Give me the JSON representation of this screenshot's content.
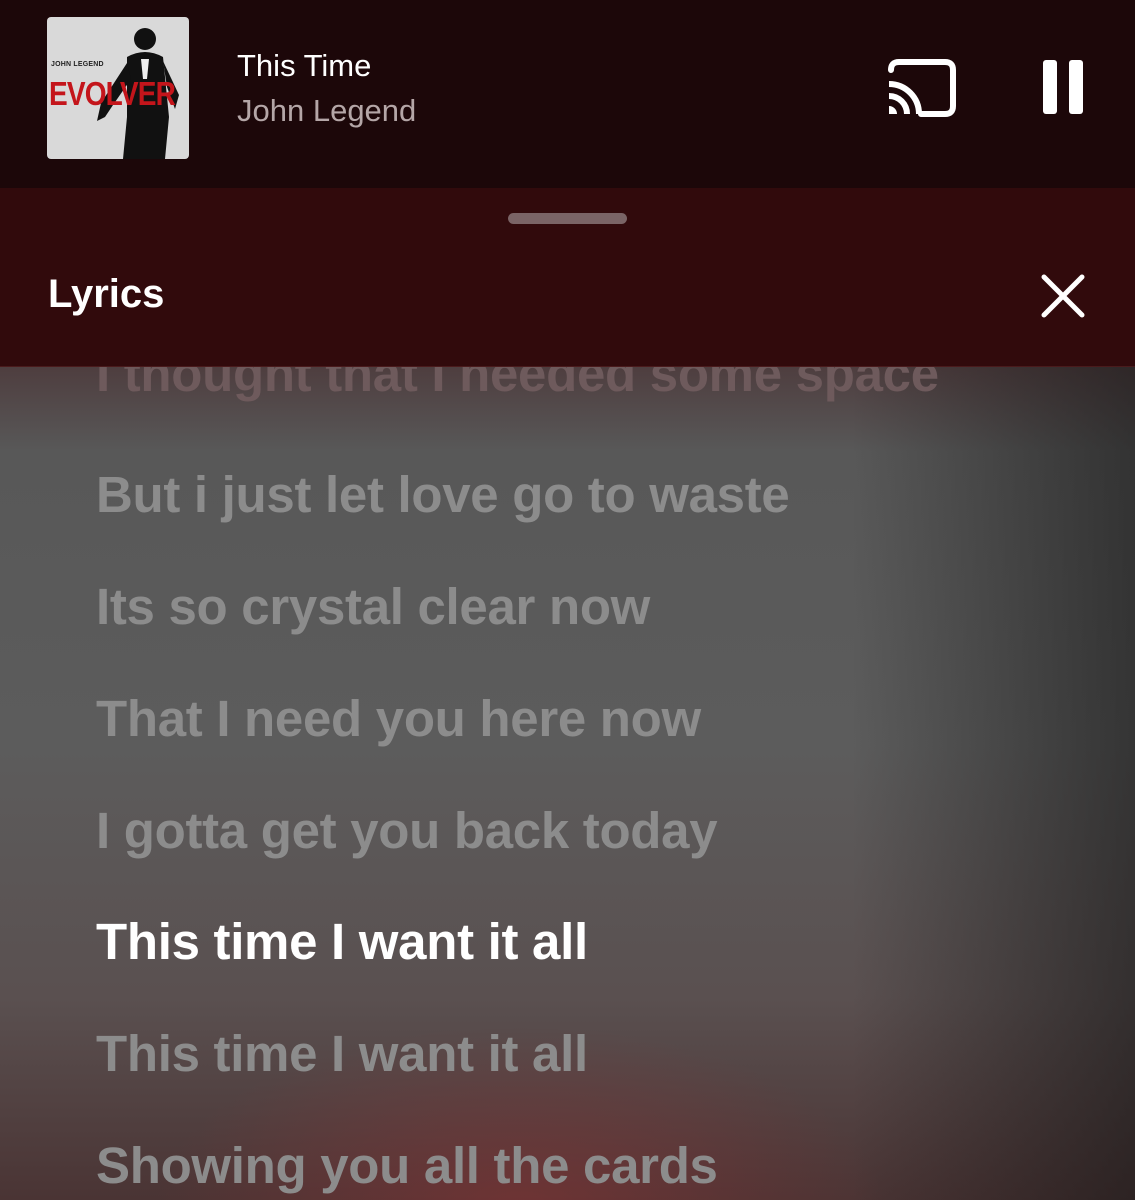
{
  "now_playing": {
    "title": "This Time",
    "artist": "John Legend",
    "album_art": {
      "artist_text": "JOHN LEGEND",
      "album_text": "EVOLVER"
    }
  },
  "controls": {
    "cast_icon": "cast-icon",
    "pause_icon": "pause-icon"
  },
  "lyrics_panel": {
    "title": "Lyrics",
    "close_icon": "close-icon",
    "lines": [
      "I thought that I needed some space",
      "But i just let love go to waste",
      "Its so crystal clear now",
      "That I need you here now",
      "I gotta get you back today",
      "This time I want it all",
      "This time I want it all",
      "Showing you all the cards"
    ],
    "active_index": 5
  },
  "colors": {
    "mini_player_bg": "#1c0709",
    "sheet_header_bg": "#310a0c",
    "active_lyric": "#ffffff",
    "inactive_lyric": "#8c8c8c",
    "album_title_red": "#c4151b"
  }
}
